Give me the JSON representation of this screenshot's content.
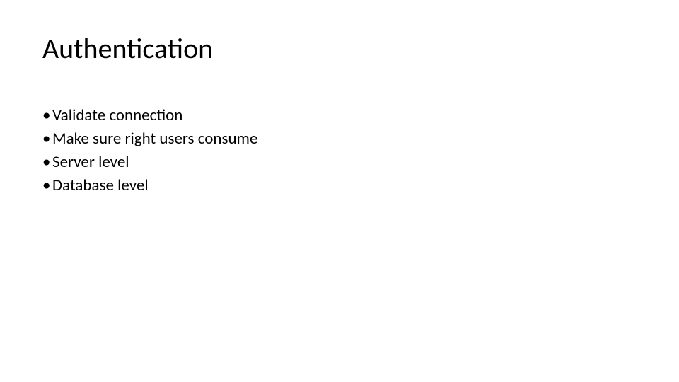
{
  "slide": {
    "title": "Authentication",
    "bullets": [
      "Validate connection",
      "Make sure right users consume",
      "Server level",
      "Database level"
    ]
  }
}
